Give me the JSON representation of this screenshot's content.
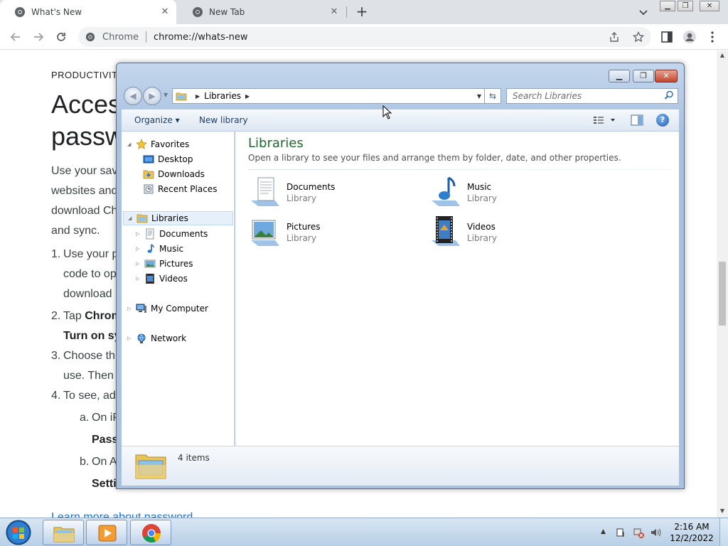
{
  "browser": {
    "tabs": [
      {
        "title": "What's New",
        "active": true
      },
      {
        "title": "New Tab",
        "active": false
      }
    ],
    "omnibox": {
      "site_chip": "Chrome",
      "url": "chrome://whats-new"
    },
    "icons": [
      "back-icon",
      "forward-icon",
      "reload-icon",
      "share-icon",
      "star-icon",
      "side-panel-icon",
      "profile-icon",
      "menu-icon"
    ]
  },
  "page": {
    "eyebrow": "PRODUCTIVIT",
    "heading_line1": "Acces",
    "heading_line2": "passw",
    "paragraph": [
      "Use your sav",
      "websites and",
      "download Ch",
      "and sync."
    ],
    "steps": [
      {
        "num": "1.",
        "lines": [
          "Use your p",
          "code to op",
          "download"
        ]
      },
      {
        "num": "2.",
        "line1_pre": "Tap ",
        "line1_bold": "Chrom",
        "line2_bold": "Turn on sy"
      },
      {
        "num": "3.",
        "lines": [
          "Choose th",
          "use. Then"
        ]
      },
      {
        "num": "4.",
        "lines": [
          "To see, ad"
        ]
      }
    ],
    "substeps": [
      {
        "letter": "a.",
        "text": "On iP",
        "bold": "Pass"
      },
      {
        "letter": "b.",
        "text": "On A",
        "bold": "Setti"
      }
    ],
    "link_text": "Learn more about password"
  },
  "explorer": {
    "address": {
      "location": "Libraries"
    },
    "search_placeholder": "Search Libraries",
    "commands": {
      "organize": "Organize ▾",
      "new_library": "New library"
    },
    "nav": {
      "favorites": {
        "label": "Favorites",
        "items": [
          "Desktop",
          "Downloads",
          "Recent Places"
        ]
      },
      "libraries": {
        "label": "Libraries",
        "items": [
          "Documents",
          "Music",
          "Pictures",
          "Videos"
        ]
      },
      "computer": "My Computer",
      "network": "Network"
    },
    "content": {
      "title": "Libraries",
      "subtitle": "Open a library to see your files and arrange them by folder, date, and other properties.",
      "libraries": [
        {
          "name": "Documents",
          "kind": "Library",
          "icon": "documents-library-icon"
        },
        {
          "name": "Music",
          "kind": "Library",
          "icon": "music-library-icon"
        },
        {
          "name": "Pictures",
          "kind": "Library",
          "icon": "pictures-library-icon"
        },
        {
          "name": "Videos",
          "kind": "Library",
          "icon": "videos-library-icon"
        }
      ]
    },
    "details": {
      "count": "4 items"
    }
  },
  "taskbar": {
    "apps": [
      "file-explorer",
      "media-player",
      "chrome"
    ],
    "clock": {
      "time": "2:16 AM",
      "date": "12/2/2022"
    }
  },
  "colors": {
    "library_title": "#1e6b30",
    "taskbar": "#c8daed",
    "accent": "#1a73e8"
  }
}
